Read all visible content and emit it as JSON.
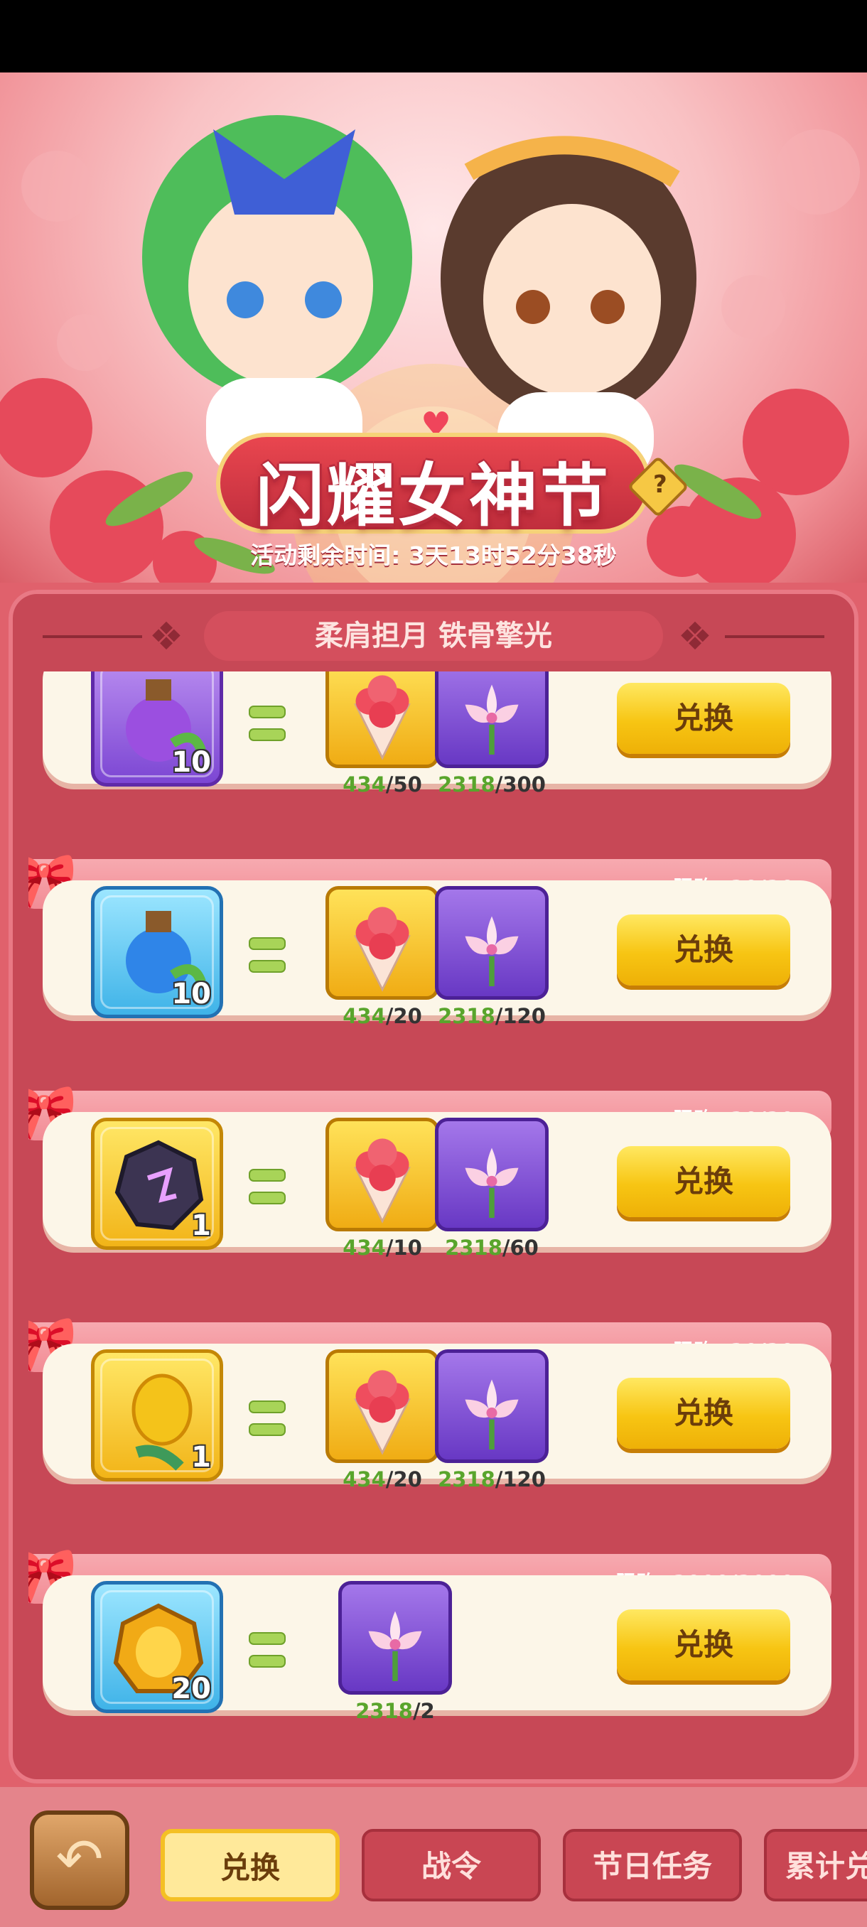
{
  "event": {
    "title": "闪耀女神节",
    "help_label": "?",
    "timer": "活动剩余时间: 3天13时52分38秒"
  },
  "panel": {
    "subtitle": "柔肩担月 铁骨擎光"
  },
  "exchange_items": [
    {
      "reward_icon": "purple-potion-icon",
      "reward_qty": "10",
      "reward_frame": "purple",
      "limit": "",
      "costs": [
        {
          "icon": "rose-bouquet-icon",
          "owned": "434",
          "need": "/50",
          "frame": "gold"
        },
        {
          "icon": "lily-flower-icon",
          "owned": "2318",
          "need": "/300",
          "frame": "purple"
        }
      ],
      "button": "兑换"
    },
    {
      "reward_icon": "blue-potion-icon",
      "reward_qty": "10",
      "reward_frame": "blue",
      "limit": "限购: 20/20",
      "costs": [
        {
          "icon": "rose-bouquet-icon",
          "owned": "434",
          "need": "/20",
          "frame": "gold"
        },
        {
          "icon": "lily-flower-icon",
          "owned": "2318",
          "need": "/120",
          "frame": "purple"
        }
      ],
      "button": "兑换"
    },
    {
      "reward_icon": "rune-stone-icon",
      "reward_qty": "1",
      "reward_frame": "gold",
      "limit": "限购: 20/20",
      "costs": [
        {
          "icon": "rose-bouquet-icon",
          "owned": "434",
          "need": "/10",
          "frame": "gold"
        },
        {
          "icon": "lily-flower-icon",
          "owned": "2318",
          "need": "/60",
          "frame": "purple"
        }
      ],
      "button": "兑换"
    },
    {
      "reward_icon": "golden-leaf-icon",
      "reward_qty": "1",
      "reward_frame": "gold",
      "limit": "限购: 20/20",
      "costs": [
        {
          "icon": "rose-bouquet-icon",
          "owned": "434",
          "need": "/20",
          "frame": "gold"
        },
        {
          "icon": "lily-flower-icon",
          "owned": "2318",
          "need": "/120",
          "frame": "purple"
        }
      ],
      "button": "兑换"
    },
    {
      "reward_icon": "gold-coin-icon",
      "reward_qty": "20",
      "reward_frame": "blue",
      "limit": "限购: 2000/2000",
      "costs": [
        {
          "icon": "lily-flower-icon",
          "owned": "2318",
          "need": "/2",
          "frame": "purple"
        }
      ],
      "button": "兑换"
    }
  ],
  "tabs": [
    "兑换",
    "战令",
    "节日任务",
    "累计兑"
  ],
  "colors": {
    "accent_gold": "#f7c513",
    "panel_red": "#c74856",
    "count_green": "#59a52c"
  }
}
